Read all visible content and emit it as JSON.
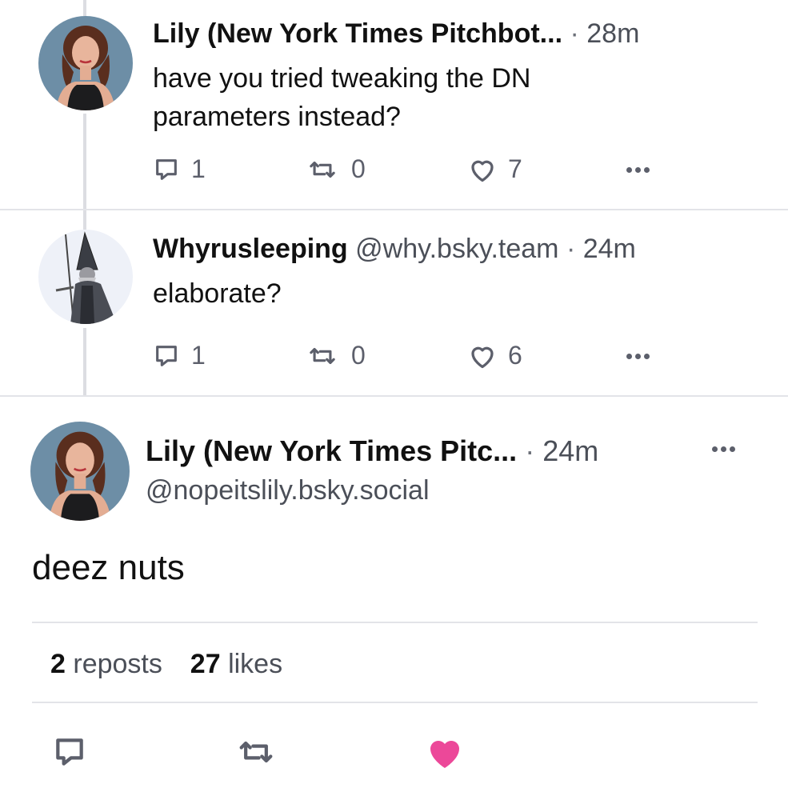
{
  "replies": [
    {
      "name": "Lily (New York Times Pitchbot...",
      "handle": "",
      "separator": "·",
      "time": "28m",
      "text_lines": [
        "have you tried tweaking the DN",
        "parameters instead?"
      ],
      "reply_count": "1",
      "repost_count": "0",
      "like_count": "7",
      "avatar_icon": "woman-portrait-avatar"
    },
    {
      "name": "Whyrusleeping",
      "handle": "@why.bsky.team",
      "separator": "·",
      "time": "24m",
      "text_lines": [
        "elaborate?"
      ],
      "reply_count": "1",
      "repost_count": "0",
      "like_count": "6",
      "avatar_icon": "wizard-avatar"
    }
  ],
  "focused": {
    "name": "Lily (New York Times Pitc...",
    "separator": "·",
    "time": "24m",
    "handle": "@nopeitslily.bsky.social",
    "text": "deez nuts",
    "reposts_count": "2",
    "reposts_label": "reposts",
    "likes_count": "27",
    "likes_label": "likes",
    "liked": true
  },
  "colors": {
    "icon_gray": "#5c5f6b",
    "like_pink": "#ec4899",
    "thread_line": "#dcdde2",
    "divider": "#e3e4e8"
  }
}
